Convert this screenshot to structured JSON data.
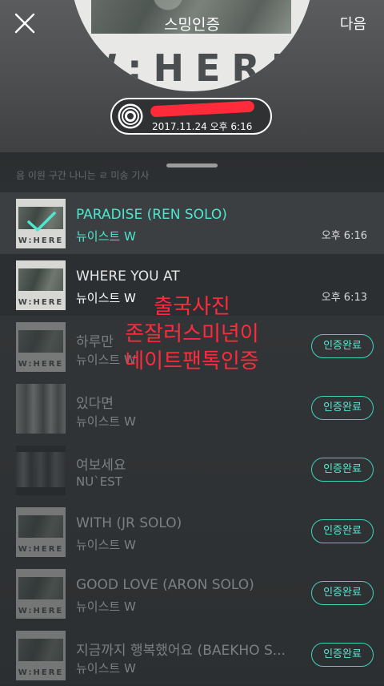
{
  "header": {
    "title": "스밍인증",
    "next_label": "다음",
    "album_cover_text": "W:HERE",
    "song_pill": {
      "datetime": "2017.11.24 오후 6:16"
    }
  },
  "list": {
    "hint_text": "음 이원 구간 나니는 ㄹ 미송 기사",
    "songs": [
      {
        "title": "PARADISE (REN SOLO)",
        "artist": "뉴이스트 W",
        "time": "오후 6:16"
      },
      {
        "title": "WHERE YOU AT",
        "artist": "뉴이스트 W",
        "time": "오후 6:13"
      },
      {
        "title": "하루만",
        "artist": "뉴이스트 W",
        "badge": "인증완료"
      },
      {
        "title": "있다면",
        "artist": "뉴이스트 W",
        "badge": "인증완료"
      },
      {
        "title": "여보세요",
        "artist": "NU`EST",
        "badge": "인증완료"
      },
      {
        "title": "WITH (JR SOLO)",
        "artist": "뉴이스트 W",
        "badge": "인증완료"
      },
      {
        "title": "GOOD LOVE (ARON SOLO)",
        "artist": "뉴이스트 W",
        "badge": "인증완료"
      },
      {
        "title": "지금까지 행복했어요 (BAEKHO S...",
        "artist": "뉴이스트 W",
        "badge": "인증완료"
      }
    ]
  },
  "overlay": {
    "line1": "출국사진",
    "line2": "존잘러스미년이",
    "line3": "네이트팬톡인증"
  },
  "colors": {
    "accent": "#4ee6cf",
    "overlay_red": "#ff2b3c"
  }
}
